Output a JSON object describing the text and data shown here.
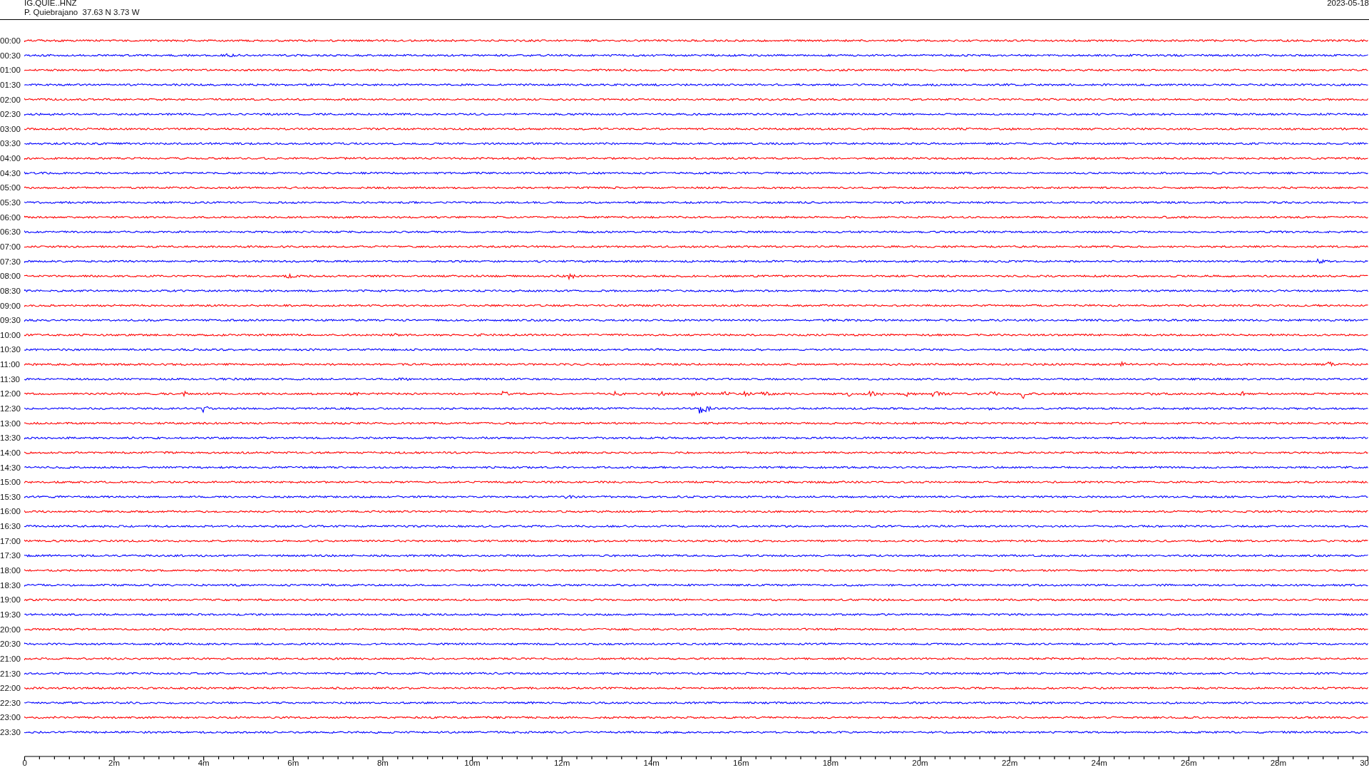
{
  "header": {
    "station": "IG.QUIE..HNZ",
    "location": "P. Quiebrajano  37.63 N 3.73 W",
    "date": "2023-05-18"
  },
  "helicorder": {
    "traces": [
      {
        "time": "00:00",
        "color": "#ff0000"
      },
      {
        "time": "00:30",
        "color": "#0000ff"
      },
      {
        "time": "01:00",
        "color": "#ff0000"
      },
      {
        "time": "01:30",
        "color": "#0000ff"
      },
      {
        "time": "02:00",
        "color": "#ff0000"
      },
      {
        "time": "02:30",
        "color": "#0000ff"
      },
      {
        "time": "03:00",
        "color": "#ff0000"
      },
      {
        "time": "03:30",
        "color": "#0000ff"
      },
      {
        "time": "04:00",
        "color": "#ff0000"
      },
      {
        "time": "04:30",
        "color": "#0000ff"
      },
      {
        "time": "05:00",
        "color": "#ff0000"
      },
      {
        "time": "05:30",
        "color": "#0000ff"
      },
      {
        "time": "06:00",
        "color": "#ff0000"
      },
      {
        "time": "06:30",
        "color": "#0000ff"
      },
      {
        "time": "07:00",
        "color": "#ff0000"
      },
      {
        "time": "07:30",
        "color": "#0000ff"
      },
      {
        "time": "08:00",
        "color": "#ff0000"
      },
      {
        "time": "08:30",
        "color": "#0000ff"
      },
      {
        "time": "09:00",
        "color": "#ff0000"
      },
      {
        "time": "09:30",
        "color": "#0000ff"
      },
      {
        "time": "10:00",
        "color": "#ff0000"
      },
      {
        "time": "10:30",
        "color": "#0000ff"
      },
      {
        "time": "11:00",
        "color": "#ff0000"
      },
      {
        "time": "11:30",
        "color": "#0000ff"
      },
      {
        "time": "12:00",
        "color": "#ff0000"
      },
      {
        "time": "12:30",
        "color": "#0000ff"
      },
      {
        "time": "13:00",
        "color": "#ff0000"
      },
      {
        "time": "13:30",
        "color": "#0000ff"
      },
      {
        "time": "14:00",
        "color": "#ff0000"
      },
      {
        "time": "14:30",
        "color": "#0000ff"
      },
      {
        "time": "15:00",
        "color": "#ff0000"
      },
      {
        "time": "15:30",
        "color": "#0000ff"
      },
      {
        "time": "16:00",
        "color": "#ff0000"
      },
      {
        "time": "16:30",
        "color": "#0000ff"
      },
      {
        "time": "17:00",
        "color": "#ff0000"
      },
      {
        "time": "17:30",
        "color": "#0000ff"
      },
      {
        "time": "18:00",
        "color": "#ff0000"
      },
      {
        "time": "18:30",
        "color": "#0000ff"
      },
      {
        "time": "19:00",
        "color": "#ff0000"
      },
      {
        "time": "19:30",
        "color": "#0000ff"
      },
      {
        "time": "20:00",
        "color": "#ff0000"
      },
      {
        "time": "20:30",
        "color": "#0000ff"
      },
      {
        "time": "21:00",
        "color": "#ff0000"
      },
      {
        "time": "21:30",
        "color": "#0000ff"
      },
      {
        "time": "22:00",
        "color": "#ff0000"
      },
      {
        "time": "22:30",
        "color": "#0000ff"
      },
      {
        "time": "23:00",
        "color": "#ff0000"
      },
      {
        "time": "23:30",
        "color": "#0000ff"
      }
    ],
    "x_axis": {
      "labels": [
        "0",
        "2m",
        "4m",
        "6m",
        "8m",
        "10m",
        "12m",
        "14m",
        "16m",
        "18m",
        "20m",
        "22m",
        "24m",
        "26m",
        "28m",
        "30"
      ]
    }
  }
}
